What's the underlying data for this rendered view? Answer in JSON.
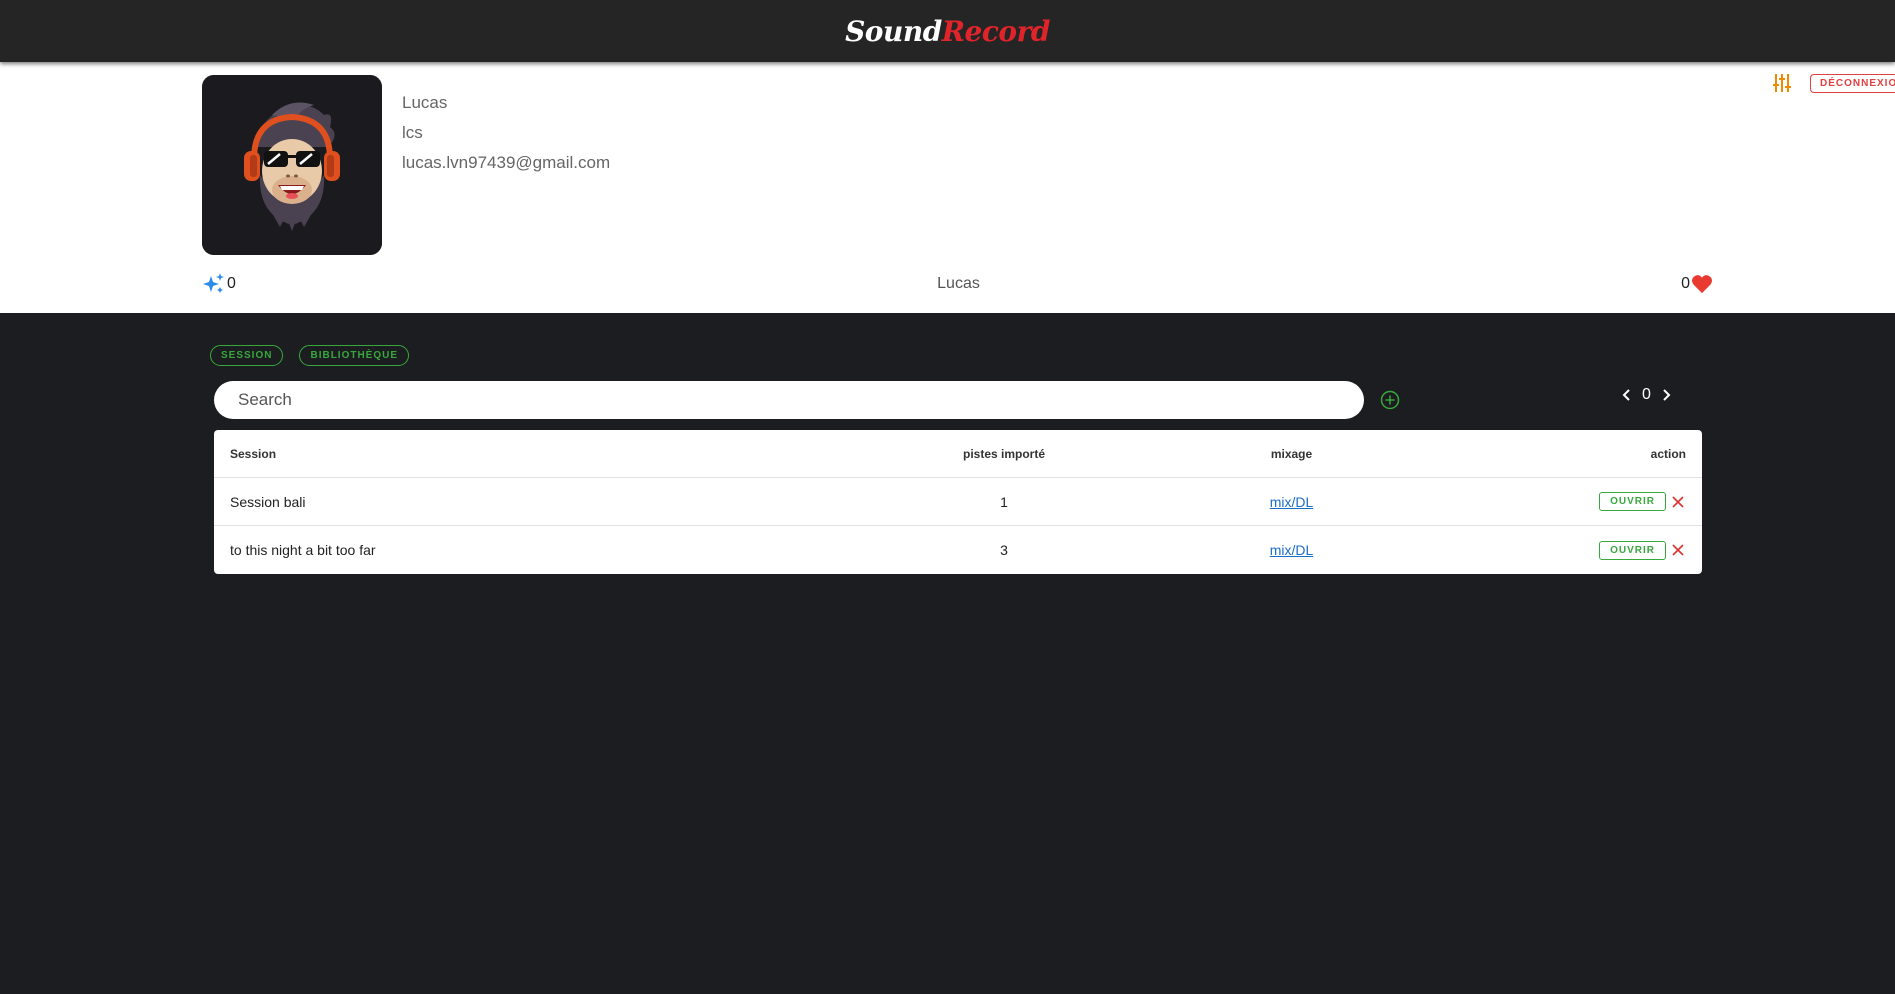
{
  "header": {
    "brand_part1": "Sound",
    "brand_part2": "Record"
  },
  "profile": {
    "first_name": "Lucas",
    "last_name": "lcs",
    "email": "lucas.lvn97439@gmail.com",
    "username": "Lucas",
    "sparkle_count": "0",
    "likes_count": "0",
    "logout_label": "DÉCONNEXION",
    "settings_icon": "sliders-icon",
    "avatar_icon": "monkey-dj-avatar"
  },
  "tabs": [
    {
      "label": "SESSION"
    },
    {
      "label": "BIBLIOTHÈQUE"
    }
  ],
  "search": {
    "placeholder": "Search"
  },
  "pager": {
    "page": "0"
  },
  "table": {
    "headers": {
      "session": "Session",
      "tracks": "pistes importé",
      "mix": "mixage",
      "action": "action"
    },
    "rows": [
      {
        "session": "Session bali",
        "tracks": "1",
        "mix": "mix/DL",
        "open": "OUVRIR"
      },
      {
        "session": "to this night a bit too far",
        "tracks": "3",
        "mix": "mix/DL",
        "open": "OUVRIR"
      }
    ]
  },
  "colors": {
    "accent_green": "#38a83c",
    "accent_red": "#e04040",
    "brand_red": "#e0242a",
    "settings_orange": "#f08a00",
    "sparkle_blue": "#2a8be8"
  }
}
